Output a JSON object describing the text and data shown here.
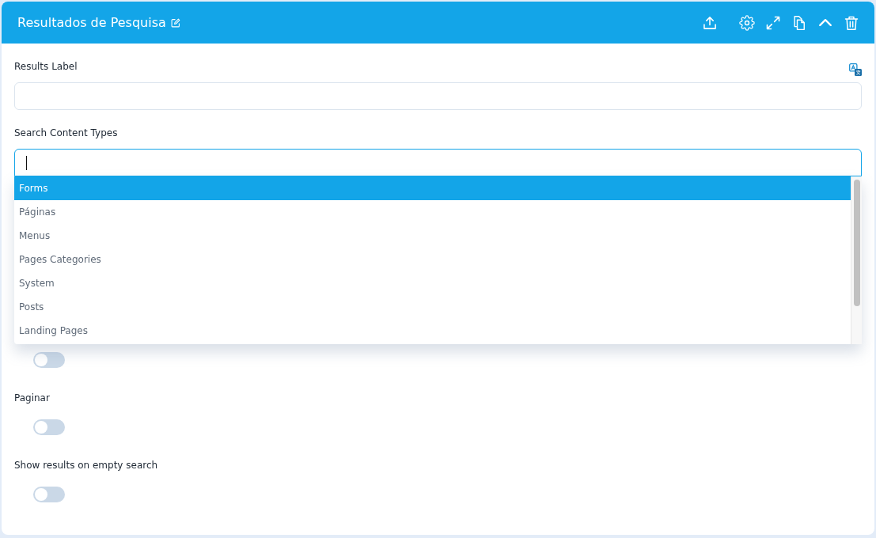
{
  "header": {
    "title": "Resultados de Pesquisa"
  },
  "fields": [
    {
      "kind": "text",
      "label": "Results Label",
      "translatable": true,
      "focused": false
    },
    {
      "kind": "select",
      "label": "Search Content Types",
      "translatable": false,
      "focused": true,
      "expanded": true,
      "options": [
        {
          "label": "Forms",
          "selected": true
        },
        {
          "label": "Páginas",
          "selected": false
        },
        {
          "label": "Menus",
          "selected": false
        },
        {
          "label": "Pages Categories",
          "selected": false
        },
        {
          "label": "System",
          "selected": false
        },
        {
          "label": "Posts",
          "selected": false
        },
        {
          "label": "Landing Pages",
          "selected": false
        }
      ]
    }
  ],
  "toggles": [
    {
      "on": false
    },
    {
      "label": "Paginar",
      "on": false
    },
    {
      "label": "Show results on empty search",
      "on": false
    }
  ]
}
